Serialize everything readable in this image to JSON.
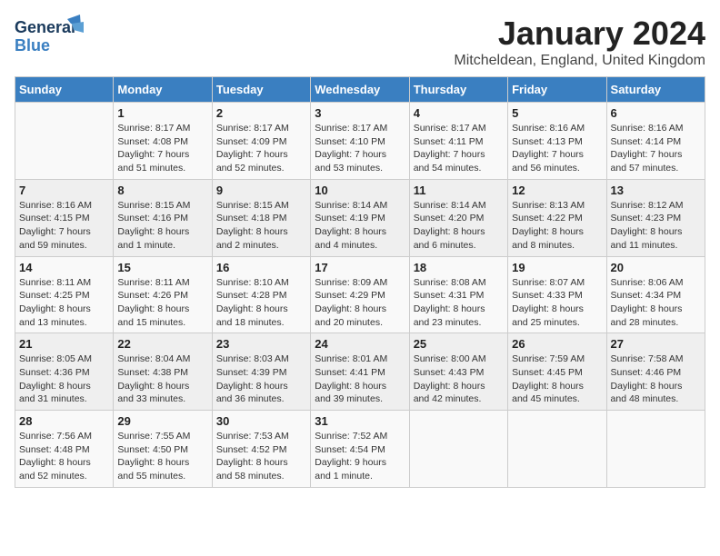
{
  "header": {
    "logo_line1": "General",
    "logo_line2": "Blue",
    "title": "January 2024",
    "subtitle": "Mitcheldean, England, United Kingdom"
  },
  "weekdays": [
    "Sunday",
    "Monday",
    "Tuesday",
    "Wednesday",
    "Thursday",
    "Friday",
    "Saturday"
  ],
  "weeks": [
    [
      {
        "day": "",
        "info": ""
      },
      {
        "day": "1",
        "info": "Sunrise: 8:17 AM\nSunset: 4:08 PM\nDaylight: 7 hours\nand 51 minutes."
      },
      {
        "day": "2",
        "info": "Sunrise: 8:17 AM\nSunset: 4:09 PM\nDaylight: 7 hours\nand 52 minutes."
      },
      {
        "day": "3",
        "info": "Sunrise: 8:17 AM\nSunset: 4:10 PM\nDaylight: 7 hours\nand 53 minutes."
      },
      {
        "day": "4",
        "info": "Sunrise: 8:17 AM\nSunset: 4:11 PM\nDaylight: 7 hours\nand 54 minutes."
      },
      {
        "day": "5",
        "info": "Sunrise: 8:16 AM\nSunset: 4:13 PM\nDaylight: 7 hours\nand 56 minutes."
      },
      {
        "day": "6",
        "info": "Sunrise: 8:16 AM\nSunset: 4:14 PM\nDaylight: 7 hours\nand 57 minutes."
      }
    ],
    [
      {
        "day": "7",
        "info": "Sunrise: 8:16 AM\nSunset: 4:15 PM\nDaylight: 7 hours\nand 59 minutes."
      },
      {
        "day": "8",
        "info": "Sunrise: 8:15 AM\nSunset: 4:16 PM\nDaylight: 8 hours\nand 1 minute."
      },
      {
        "day": "9",
        "info": "Sunrise: 8:15 AM\nSunset: 4:18 PM\nDaylight: 8 hours\nand 2 minutes."
      },
      {
        "day": "10",
        "info": "Sunrise: 8:14 AM\nSunset: 4:19 PM\nDaylight: 8 hours\nand 4 minutes."
      },
      {
        "day": "11",
        "info": "Sunrise: 8:14 AM\nSunset: 4:20 PM\nDaylight: 8 hours\nand 6 minutes."
      },
      {
        "day": "12",
        "info": "Sunrise: 8:13 AM\nSunset: 4:22 PM\nDaylight: 8 hours\nand 8 minutes."
      },
      {
        "day": "13",
        "info": "Sunrise: 8:12 AM\nSunset: 4:23 PM\nDaylight: 8 hours\nand 11 minutes."
      }
    ],
    [
      {
        "day": "14",
        "info": "Sunrise: 8:11 AM\nSunset: 4:25 PM\nDaylight: 8 hours\nand 13 minutes."
      },
      {
        "day": "15",
        "info": "Sunrise: 8:11 AM\nSunset: 4:26 PM\nDaylight: 8 hours\nand 15 minutes."
      },
      {
        "day": "16",
        "info": "Sunrise: 8:10 AM\nSunset: 4:28 PM\nDaylight: 8 hours\nand 18 minutes."
      },
      {
        "day": "17",
        "info": "Sunrise: 8:09 AM\nSunset: 4:29 PM\nDaylight: 8 hours\nand 20 minutes."
      },
      {
        "day": "18",
        "info": "Sunrise: 8:08 AM\nSunset: 4:31 PM\nDaylight: 8 hours\nand 23 minutes."
      },
      {
        "day": "19",
        "info": "Sunrise: 8:07 AM\nSunset: 4:33 PM\nDaylight: 8 hours\nand 25 minutes."
      },
      {
        "day": "20",
        "info": "Sunrise: 8:06 AM\nSunset: 4:34 PM\nDaylight: 8 hours\nand 28 minutes."
      }
    ],
    [
      {
        "day": "21",
        "info": "Sunrise: 8:05 AM\nSunset: 4:36 PM\nDaylight: 8 hours\nand 31 minutes."
      },
      {
        "day": "22",
        "info": "Sunrise: 8:04 AM\nSunset: 4:38 PM\nDaylight: 8 hours\nand 33 minutes."
      },
      {
        "day": "23",
        "info": "Sunrise: 8:03 AM\nSunset: 4:39 PM\nDaylight: 8 hours\nand 36 minutes."
      },
      {
        "day": "24",
        "info": "Sunrise: 8:01 AM\nSunset: 4:41 PM\nDaylight: 8 hours\nand 39 minutes."
      },
      {
        "day": "25",
        "info": "Sunrise: 8:00 AM\nSunset: 4:43 PM\nDaylight: 8 hours\nand 42 minutes."
      },
      {
        "day": "26",
        "info": "Sunrise: 7:59 AM\nSunset: 4:45 PM\nDaylight: 8 hours\nand 45 minutes."
      },
      {
        "day": "27",
        "info": "Sunrise: 7:58 AM\nSunset: 4:46 PM\nDaylight: 8 hours\nand 48 minutes."
      }
    ],
    [
      {
        "day": "28",
        "info": "Sunrise: 7:56 AM\nSunset: 4:48 PM\nDaylight: 8 hours\nand 52 minutes."
      },
      {
        "day": "29",
        "info": "Sunrise: 7:55 AM\nSunset: 4:50 PM\nDaylight: 8 hours\nand 55 minutes."
      },
      {
        "day": "30",
        "info": "Sunrise: 7:53 AM\nSunset: 4:52 PM\nDaylight: 8 hours\nand 58 minutes."
      },
      {
        "day": "31",
        "info": "Sunrise: 7:52 AM\nSunset: 4:54 PM\nDaylight: 9 hours\nand 1 minute."
      },
      {
        "day": "",
        "info": ""
      },
      {
        "day": "",
        "info": ""
      },
      {
        "day": "",
        "info": ""
      }
    ]
  ]
}
